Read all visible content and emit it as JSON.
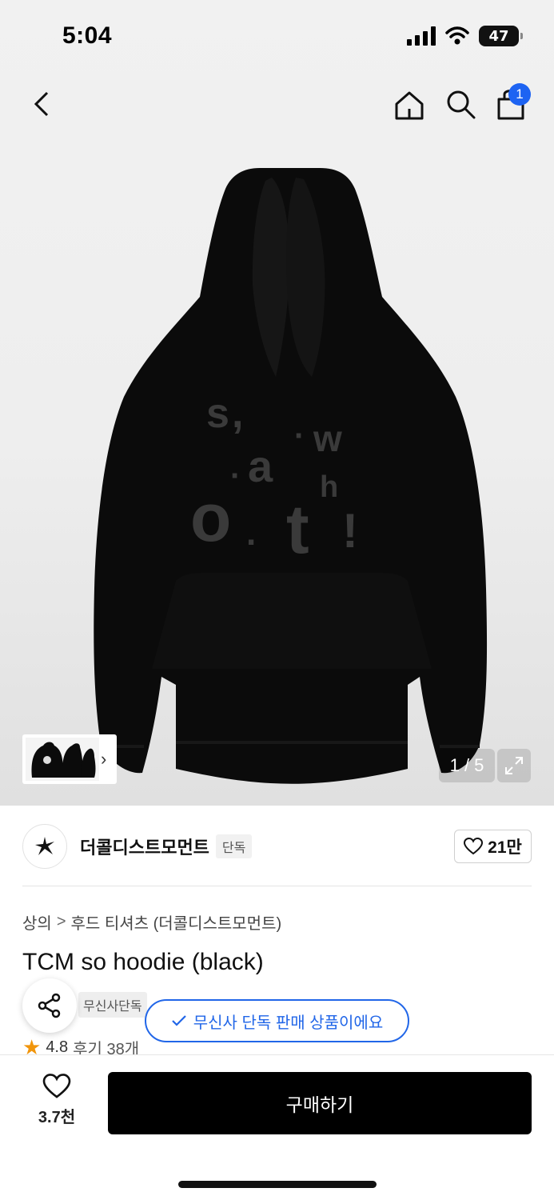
{
  "status_bar": {
    "time": "5:04",
    "battery": "47"
  },
  "header": {
    "cart_count": "1"
  },
  "gallery": {
    "print_letters": [
      "s",
      ",",
      "·",
      "w",
      "·",
      "a",
      "h",
      "o",
      ".",
      "t",
      "!"
    ],
    "page_indicator": "1 / 5"
  },
  "brand": {
    "name": "더콜디스트모먼트",
    "tag": "단독",
    "likes": "21만"
  },
  "breadcrumb": {
    "level1": "상의",
    "level2": "후드 티셔츠 (더콜디스트모먼트)",
    "separator": ">"
  },
  "product": {
    "title": "TCM so hoodie (black)",
    "exclusive_badge": "무신사단독",
    "tooltip": "무신사 단독 판매 상품이에요",
    "rating": "4.8",
    "review_text": "후기 38개"
  },
  "bottom_bar": {
    "wish_count": "3.7천",
    "buy_label": "구매하기"
  },
  "colors": {
    "accent_blue": "#1d63f2",
    "star": "#f1950b",
    "buy_button": "#000000"
  }
}
